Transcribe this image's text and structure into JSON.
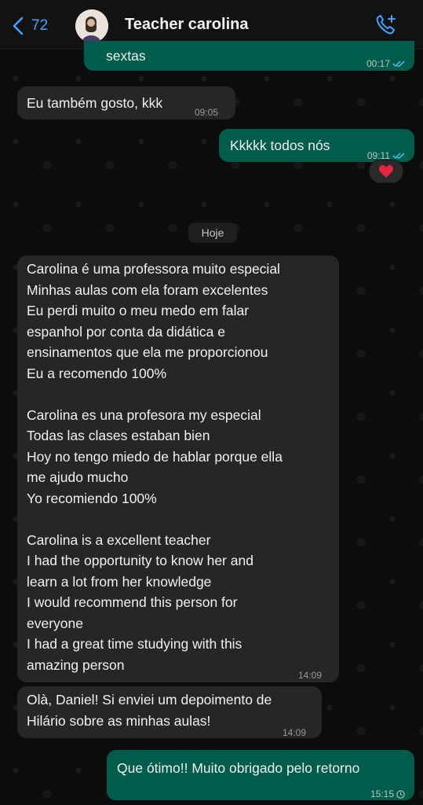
{
  "header": {
    "back_count": "72",
    "contact_name": "Teacher carolina"
  },
  "messages": {
    "m1": {
      "text": "sextas",
      "time": "00:17"
    },
    "m2": {
      "text": "Eu também gosto, kkk",
      "time": "09:05"
    },
    "m3": {
      "text": "Kkkkk todos nós",
      "time": "09:11",
      "reaction": "❤️"
    },
    "date_divider": "Hoje",
    "m4": {
      "lines": [
        "Carolina é uma professora muito especial",
        "Minhas aulas com ela foram excelentes",
        "Eu perdi muito o meu medo em falar",
        "espanhol por conta da didática e",
        "ensinamentos que ela me proporcionou",
        "Eu a recomendo 100%",
        "",
        "Carolina es una profesora my especial",
        "Todas las clases estaban bien",
        "Hoy no tengo miedo de hablar porque ella",
        "me ajudo mucho",
        "Yo recomiendo 100%",
        "",
        "Carolina is a excellent teacher",
        "I had the opportunity to know her and",
        "learn a lot from her knowledge",
        "I would recommend this person for",
        "everyone",
        "I had a great time studying with this",
        "amazing person"
      ],
      "time": "14:09"
    },
    "m5": {
      "lines": [
        "Olà, Daniel! Si enviei um depoimento de",
        "Hilário sobre as minhas aulas!"
      ],
      "time": "14:09"
    },
    "m6": {
      "text": "Que ótimo!! Muito obrigado pelo retorno",
      "time": "15:15"
    }
  },
  "colors": {
    "accent": "#3aa6ff",
    "outgoing_bubble": "#005c4b",
    "incoming_bubble": "#262626",
    "background": "#0b0b0b"
  },
  "icons": [
    "chevron-left-icon",
    "avatar",
    "add-call-icon",
    "double-check-icon",
    "clock-icon",
    "heart-icon"
  ]
}
